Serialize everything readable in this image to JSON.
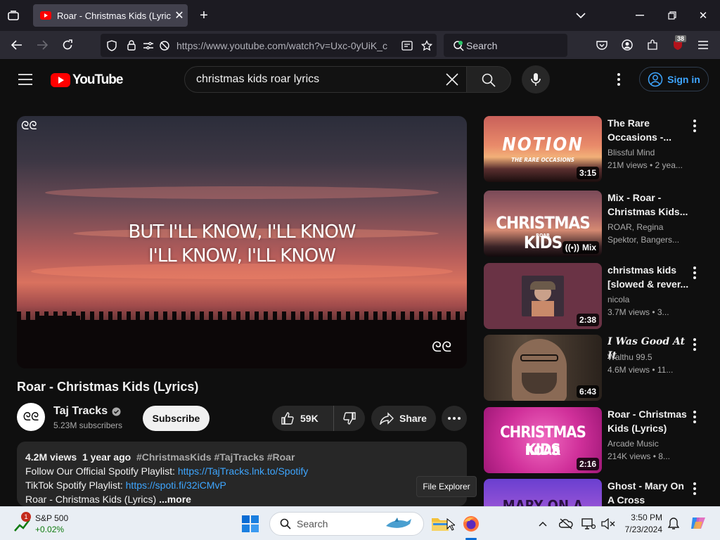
{
  "browser": {
    "tab_title": "Roar - Christmas Kids (Lyrics) -",
    "url": "https://www.youtube.com/watch?v=Uxc-0yUiK_c",
    "search_placeholder": "Search",
    "extension_badge": "38"
  },
  "youtube": {
    "logo_text": "YouTube",
    "search_query": "christmas kids roar lyrics",
    "sign_in_label": "Sign in"
  },
  "video": {
    "lyrics_line1": "BUT I'LL KNOW, I'LL KNOW",
    "lyrics_line2": "I'LL KNOW, I'LL KNOW",
    "watermark": "ᘓᘓ",
    "title": "Roar - Christmas Kids (Lyrics)",
    "channel_name": "Taj Tracks",
    "subscribers": "5.23M subscribers",
    "subscribe_label": "Subscribe",
    "likes": "59K",
    "share_label": "Share",
    "description": {
      "views": "4.2M views",
      "age": "1 year ago",
      "hashtags": "#ChristmasKids #TajTracks #Roar",
      "line1_text": "Follow Our Official Spotify Playlist: ",
      "line1_link": "https://TajTracks.lnk.to/Spotify",
      "line2_text": "TikTok Spotify Playlist: ",
      "line2_link": "https://spoti.fi/32iCMvP",
      "line3_text": "Roar - Christmas Kids (Lyrics)",
      "more_label": "...more"
    }
  },
  "recommendations": [
    {
      "title": "The Rare Occasions -...",
      "channel": "Blissful Mind",
      "meta": "21M views • 2 yea...",
      "duration": "3:15",
      "thumb_text1": "NOTION",
      "thumb_text2": "THE RARE OCCASIONS"
    },
    {
      "title": "Mix - Roar - Christmas Kids...",
      "channel": "ROAR, Regina",
      "meta": "Spektor, Bangers...",
      "duration": "Mix",
      "thumb_text1": "CHRISTMAS KIDS",
      "thumb_text2": "ROAR"
    },
    {
      "title": "christmas kids [slowed & rever...",
      "channel": "nicola",
      "meta": "3.7M views • 3...",
      "duration": "2:38"
    },
    {
      "title": "I Was Good At It",
      "channel": "Walthu 99.5",
      "meta": "4.6M views • 11...",
      "duration": "6:43"
    },
    {
      "title": "Roar - Christmas Kids (Lyrics)",
      "channel": "Arcade Music",
      "meta": "214K views • 8...",
      "duration": "2:16",
      "thumb_text1": "CHRISTMAS KIDS",
      "thumb_text2": "ROAR"
    },
    {
      "title": "Ghost - Mary On A Cross",
      "thumb_text1": "MARY ON A CROSS"
    }
  ],
  "tooltip": "File Explorer",
  "taskbar": {
    "stock_name": "S&P 500",
    "stock_change": "+0.02%",
    "stock_badge": "1",
    "search_placeholder": "Search",
    "time": "3:50 PM",
    "date": "7/23/2024"
  },
  "colors": {
    "youtube_red": "#ff0000",
    "link_blue": "#3ea6ff",
    "stock_green": "#0f7b0f"
  }
}
